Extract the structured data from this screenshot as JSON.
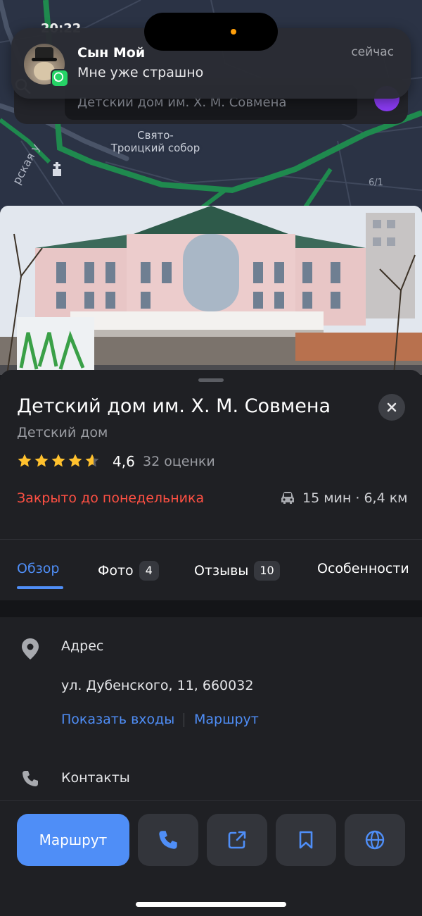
{
  "status_bar": {
    "time": "20:22"
  },
  "notification": {
    "app_icon": "whatsapp-icon",
    "sender": "Сын Мой",
    "message": "Мне уже страшно",
    "time": "сейчас"
  },
  "map": {
    "labels": [
      "Свято-\nТроицкий собор"
    ],
    "street": "рская у",
    "house_number": "6/1",
    "search_text": "Детский дом им. Х. М. Совмена",
    "accent_color": "#8b3bf4"
  },
  "place": {
    "title": "Детский дом им. Х. М. Совмена",
    "category": "Детский дом",
    "rating": "4,6",
    "rating_value": 4.6,
    "rating_count": "32 оценки",
    "hours_status": "Закрыто до понедельника",
    "hours_color": "#ff5043",
    "travel": "15 мин · 6,4 км"
  },
  "tabs": [
    {
      "label": "Обзор",
      "count": ""
    },
    {
      "label": "Фото",
      "count": "4"
    },
    {
      "label": "Отзывы",
      "count": "10"
    },
    {
      "label": "Особенности",
      "count": ""
    }
  ],
  "address": {
    "label": "Адрес",
    "value": "ул. Дубенского, 11, 660032",
    "show_entrances": "Показать входы",
    "route_link": "Маршрут"
  },
  "contacts": {
    "label": "Контакты"
  },
  "actions": {
    "route_button": "Маршрут",
    "accent_color": "#4f8ef7",
    "icons": [
      "phone-icon",
      "share-icon",
      "bookmark-icon",
      "globe-icon"
    ]
  }
}
